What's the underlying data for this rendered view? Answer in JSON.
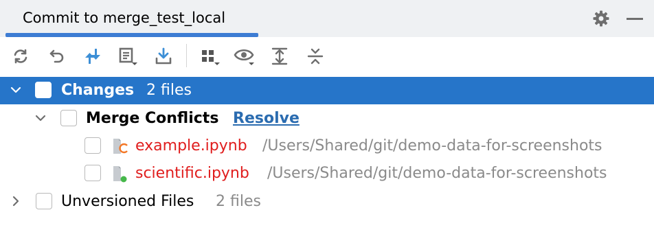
{
  "tab": {
    "label": "Commit to merge_test_local"
  },
  "toolbar": {
    "buttons": [
      "refresh-icon",
      "rollback-icon",
      "merge-arrows-icon",
      "diff-icon",
      "update-icon",
      "group-by-icon",
      "view-options-icon",
      "expand-all-icon",
      "collapse-all-icon"
    ]
  },
  "tree": {
    "changes": {
      "label": "Changes",
      "count": "2 files"
    },
    "merge_conflicts": {
      "label": "Merge Conflicts",
      "action": "Resolve"
    },
    "files": [
      {
        "name": "example.ipynb",
        "path": "/Users/Shared/git/demo-data-for-screenshots"
      },
      {
        "name": "scientific.ipynb",
        "path": "/Users/Shared/git/demo-data-for-screenshots"
      }
    ],
    "unversioned": {
      "label": "Unversioned Files",
      "count": "2 files"
    }
  },
  "colors": {
    "accent": "#3d7cd3",
    "selection": "#2675c9",
    "conflict": "#e01d1d",
    "link": "#2b6cb0",
    "muted": "#8a8a8a"
  }
}
